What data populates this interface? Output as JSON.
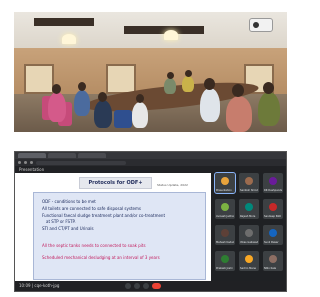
{
  "meet": {
    "window_title": "Presentation",
    "controls_text": "10:09 | cqe-koth-jpg"
  },
  "slide": {
    "title": "Protocols for ODF+",
    "subtitle": "Status Update, 2022",
    "bullets": [
      "ODF - conditions to be met",
      "All toilets are connected to safe disposal systems",
      "Functional faecal sludge treatment plant and/or co-treatment",
      "at STP or FSTP.",
      "STI and CT/PT and Urinals",
      "All the septic tanks needs to connected to soak pits",
      "Scheduled mechanical desludging at an interval of 3 years"
    ]
  },
  "participants": [
    {
      "name": "Presentation",
      "color": "#e8a33c"
    },
    {
      "name": "Santosh Shinde",
      "color": "#9c6b4e"
    },
    {
      "name": "RR Deshpande",
      "color": "#6a1b9a"
    },
    {
      "name": "Avinash Jadhav",
      "color": "#7cb342"
    },
    {
      "name": "Rajesh More",
      "color": "#00897b"
    },
    {
      "name": "Sandeep Patil",
      "color": "#c62828"
    },
    {
      "name": "Mahesh Kadam",
      "color": "#5d4037"
    },
    {
      "name": "Vikas Gaikwad",
      "color": "#6d6d6d"
    },
    {
      "name": "Sunil Pawar",
      "color": "#1565c0"
    },
    {
      "name": "Prakash Joshi",
      "color": "#2e7d32"
    },
    {
      "name": "Sachin Mane",
      "color": "#f9a825"
    },
    {
      "name": "Nitin Kale",
      "color": "#8d6e63"
    }
  ]
}
